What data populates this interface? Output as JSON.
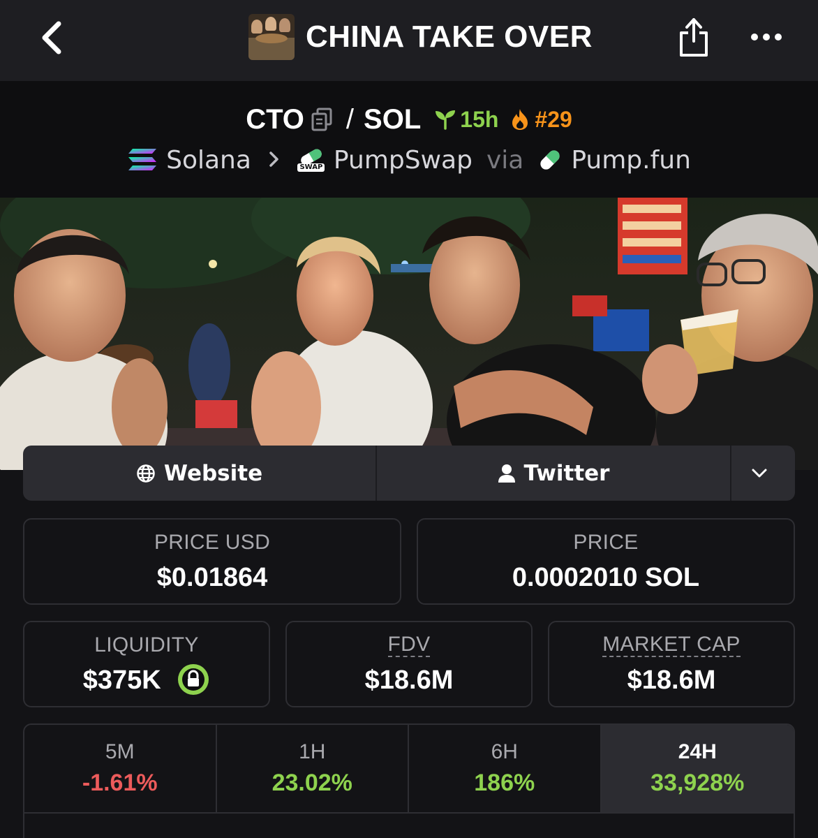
{
  "header": {
    "title": "CHINA TAKE OVER",
    "back_icon": "chevron-left-icon",
    "share_icon": "share-icon",
    "more_icon": "more-horizontal-icon"
  },
  "pair": {
    "base": "CTO",
    "separator": "/",
    "quote": "SOL",
    "age": "15h",
    "rank": "#29",
    "chain": "Solana",
    "dex": "PumpSwap",
    "dex_badge": "SWAP",
    "via": "via",
    "launchpad": "Pump.fun"
  },
  "links": {
    "website": "Website",
    "twitter": "Twitter"
  },
  "stats": {
    "price_usd_label": "PRICE USD",
    "price_usd": "$0.01864",
    "price_label": "PRICE",
    "price_native": "0.0002010 SOL",
    "liquidity_label": "LIQUIDITY",
    "liquidity": "$375K",
    "fdv_label": "FDV",
    "fdv": "$18.6M",
    "mcap_label": "MARKET CAP",
    "mcap": "$18.6M"
  },
  "timeframes": [
    {
      "label": "5M",
      "value": "-1.61%"
    },
    {
      "label": "1H",
      "value": "23.02%"
    },
    {
      "label": "6H",
      "value": "186%"
    },
    {
      "label": "24H",
      "value": "33,928%"
    }
  ],
  "colors": {
    "positive": "#8ed24e",
    "negative": "#ec5b5b",
    "rank": "#f7931a",
    "background": "#131316"
  }
}
